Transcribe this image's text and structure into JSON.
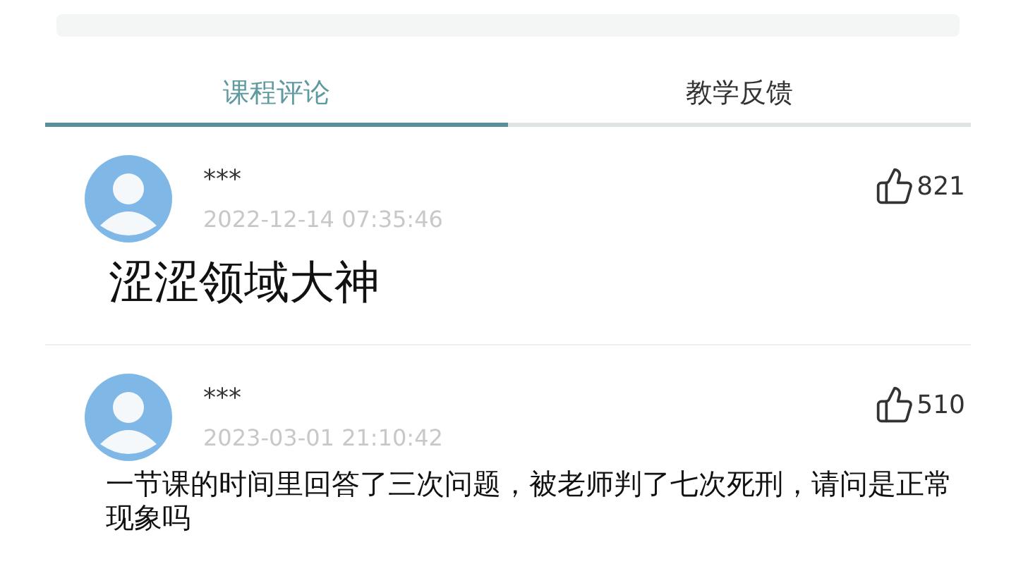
{
  "tabs": [
    {
      "label": "课程评论",
      "selected": true
    },
    {
      "label": "教学反馈",
      "selected": false
    }
  ],
  "comments": [
    {
      "name": "***",
      "time": "2022-12-14 07:35:46",
      "likes": "821",
      "kind": "large",
      "text": "涩涩领域大神"
    },
    {
      "name": "***",
      "time": "2023-03-01 21:10:42",
      "likes": "510",
      "kind": "normal",
      "text": "一节课的时间里回答了三次问题，被老师判了七次死刑，请问是正常现象吗"
    }
  ]
}
